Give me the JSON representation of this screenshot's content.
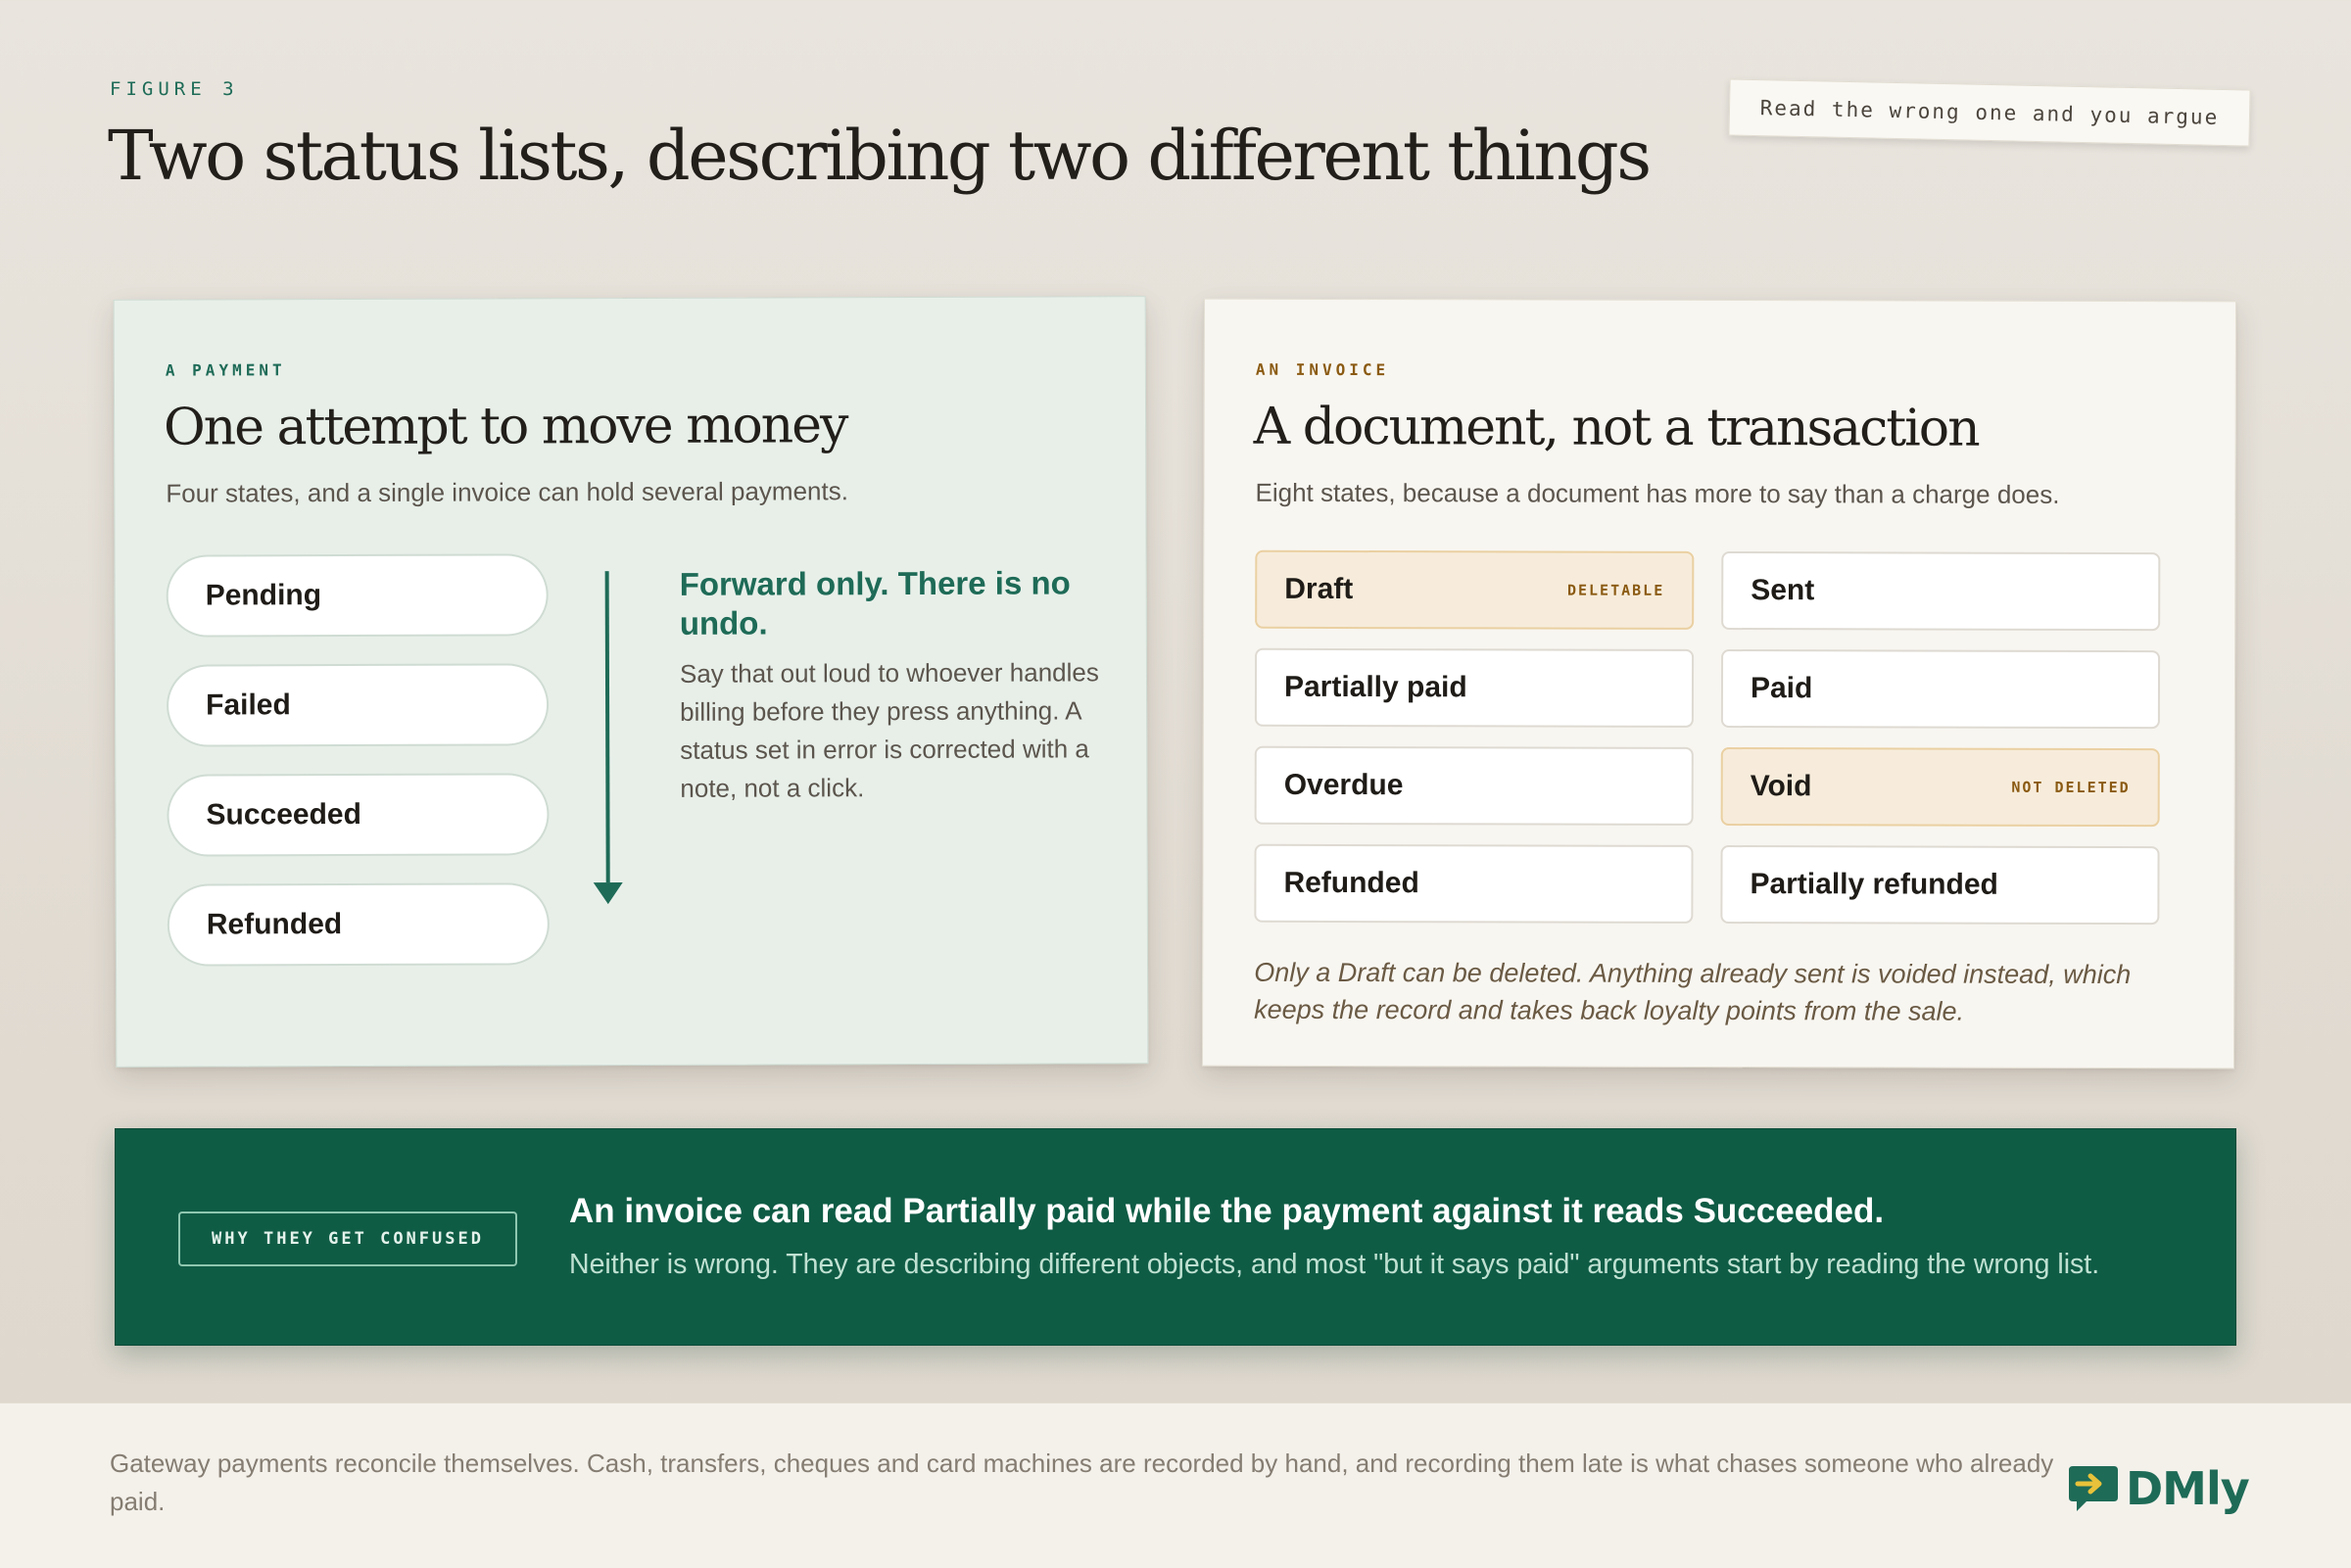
{
  "header": {
    "eyebrow": "FIGURE 3",
    "title": "Two status lists, describing two different things",
    "note": "Read the wrong one and you argue"
  },
  "payment_card": {
    "label": "A PAYMENT",
    "title": "One attempt to move money",
    "subtitle": "Four states, and a single invoice can hold several payments.",
    "states": [
      "Pending",
      "Failed",
      "Succeeded",
      "Refunded"
    ],
    "flow_heading": "Forward only. There is no undo.",
    "flow_body": "Say that out loud to whoever handles billing before they press anything. A status set in error is corrected with a note, not a click."
  },
  "invoice_card": {
    "label": "AN INVOICE",
    "title": "A document, not a transaction",
    "subtitle": "Eight states, because a document has more to say than a charge does.",
    "states": [
      {
        "label": "Draft",
        "tag": "DELETABLE"
      },
      {
        "label": "Sent",
        "tag": ""
      },
      {
        "label": "Partially paid",
        "tag": ""
      },
      {
        "label": "Paid",
        "tag": ""
      },
      {
        "label": "Overdue",
        "tag": ""
      },
      {
        "label": "Void",
        "tag": "NOT DELETED"
      },
      {
        "label": "Refunded",
        "tag": ""
      },
      {
        "label": "Partially refunded",
        "tag": ""
      }
    ],
    "footnote": "Only a Draft can be deleted. Anything already sent is voided instead, which keeps the record and takes back loyalty points from the sale."
  },
  "banner": {
    "tag": "WHY THEY GET CONFUSED",
    "heading": "An invoice can read Partially paid while the payment against it reads Succeeded.",
    "body": "Neither is wrong. They are describing different objects, and most \"but it says paid\" arguments start by reading the wrong list."
  },
  "footer": {
    "text": "Gateway payments reconcile themselves. Cash, transfers, cheques and card machines are recorded by hand, and recording them late is what chases someone who already paid.",
    "logo": "DMly"
  },
  "colors": {
    "accent_green": "#1e6b57",
    "banner_green": "#0f5c45",
    "warm_tag": "#8a5a12",
    "warm_fill": "#f7ecdb"
  },
  "icons": {
    "logo": "chat-arrow-icon",
    "flow": "arrow-down-icon"
  }
}
